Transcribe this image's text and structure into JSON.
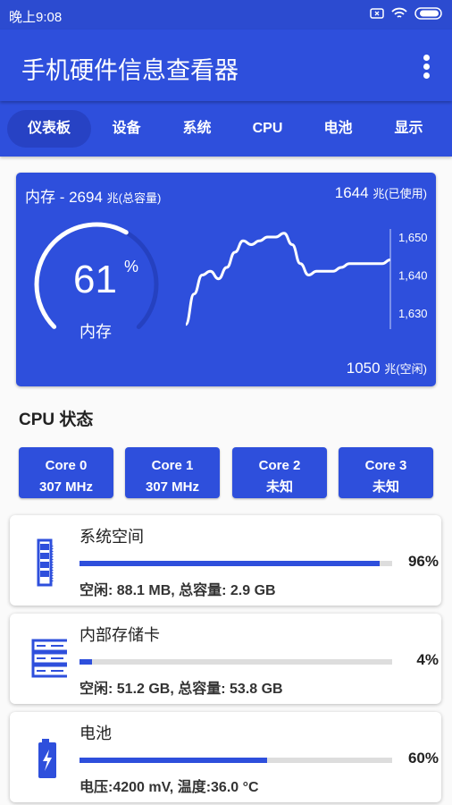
{
  "status_bar": {
    "time": "晚上9:08"
  },
  "app_bar": {
    "title": "手机硬件信息查看器"
  },
  "tabs": [
    {
      "label": "仪表板",
      "active": true
    },
    {
      "label": "设备"
    },
    {
      "label": "系统"
    },
    {
      "label": "CPU"
    },
    {
      "label": "电池"
    },
    {
      "label": "显示"
    }
  ],
  "memory": {
    "title": "内存 - 2694",
    "title_unit": "兆(总容量)",
    "used": "1644",
    "used_unit": "兆(已使用)",
    "free": "1050",
    "free_unit": "兆(空闲)",
    "percent": 61,
    "percent_text": "61",
    "percent_sign": "%",
    "gauge_label": "内存",
    "chart": {
      "type": "line",
      "y_ticks": [
        "1,650",
        "1,640",
        "1,630"
      ],
      "ylim": [
        1630,
        1650
      ],
      "values": [
        1627,
        1635,
        1640,
        1641,
        1639,
        1642,
        1646,
        1649,
        1648,
        1649,
        1650,
        1650,
        1651,
        1648,
        1643,
        1640,
        1641,
        1641,
        1641,
        1642,
        1643,
        1643,
        1643,
        1643,
        1643,
        1644
      ]
    }
  },
  "cpu": {
    "title": "CPU 状态",
    "cores": [
      {
        "name": "Core 0",
        "freq": "307 MHz"
      },
      {
        "name": "Core 1",
        "freq": "307 MHz"
      },
      {
        "name": "Core 2",
        "freq": "未知"
      },
      {
        "name": "Core 3",
        "freq": "未知"
      }
    ]
  },
  "storage": [
    {
      "name": "系统空间",
      "percent": 96,
      "percent_text": "96%",
      "detail": "空闲: 88.1 MB, 总容量: 2.9 GB",
      "icon": "memory-chip-icon"
    },
    {
      "name": "内部存储卡",
      "percent": 4,
      "percent_text": "4%",
      "detail": "空闲: 51.2 GB, 总容量: 53.8 GB",
      "icon": "server-icon"
    },
    {
      "name": "电池",
      "percent": 60,
      "percent_text": "60%",
      "detail": "电压:4200 mV, 温度:36.0 °C",
      "icon": "battery-charging-icon"
    }
  ],
  "colors": {
    "primary": "#2e4fdc",
    "track": "#dddddd"
  }
}
